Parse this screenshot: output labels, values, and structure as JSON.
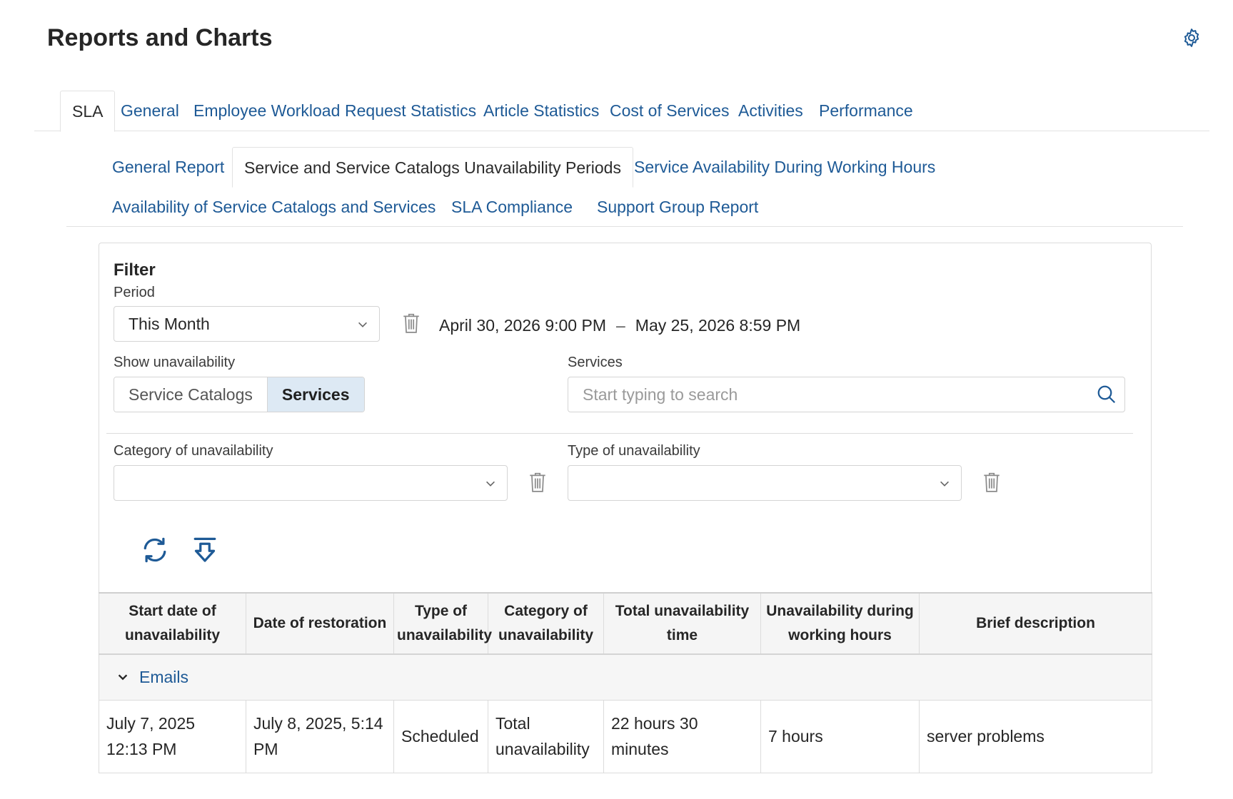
{
  "page": {
    "title": "Reports and Charts"
  },
  "main_tabs": [
    {
      "label": "SLA",
      "active": true
    },
    {
      "label": "General"
    },
    {
      "label": "Employee Workload"
    },
    {
      "label": "Request Statistics"
    },
    {
      "label": "Article Statistics"
    },
    {
      "label": "Cost of Services"
    },
    {
      "label": "Activities"
    },
    {
      "label": "Performance"
    }
  ],
  "sub_tabs": [
    {
      "label": "General Report"
    },
    {
      "label": "Service and Service Catalogs Unavailability Periods",
      "active": true
    },
    {
      "label": "Service Availability During Working Hours"
    },
    {
      "label": "Availability of Service Catalogs and Services"
    },
    {
      "label": "SLA Compliance"
    },
    {
      "label": "Support Group Report"
    }
  ],
  "filter": {
    "title": "Filter",
    "period": {
      "label": "Period",
      "value": "This Month",
      "range_start": "April 30, 2026 9:00 PM",
      "range_separator": "–",
      "range_end": "May 25, 2026 8:59 PM"
    },
    "show_unavailability": {
      "label": "Show unavailability",
      "options": [
        "Service Catalogs",
        "Services"
      ],
      "selected": "Services"
    },
    "services": {
      "label": "Services",
      "placeholder": "Start typing to search"
    },
    "category": {
      "label": "Category of unavailability",
      "value": ""
    },
    "type": {
      "label": "Type of unavailability",
      "value": ""
    }
  },
  "icons": {
    "settings": "gear-icon",
    "trash": "trash-icon",
    "search": "search-icon",
    "refresh": "refresh-icon",
    "export": "download-icon"
  },
  "table": {
    "headers": [
      "Start date of unavailability",
      "Date of restoration",
      "Type of unavailability",
      "Category of unavailability",
      "Total unavailability time",
      "Unavailability during working hours",
      "Brief description"
    ],
    "groups": [
      {
        "name": "Emails",
        "rows": [
          {
            "start": "July 7, 2025 12:13 PM",
            "restoration": "July 8, 2025, 5:14 PM",
            "type": "Scheduled",
            "category": "Total unavailability",
            "total": "22 hours 30 minutes",
            "working_hours": "7 hours",
            "description": "server problems"
          }
        ]
      }
    ]
  },
  "colors": {
    "link": "#1e5a96",
    "selected_toggle": "#dde9f4",
    "header_bg": "#f5f5f5"
  }
}
